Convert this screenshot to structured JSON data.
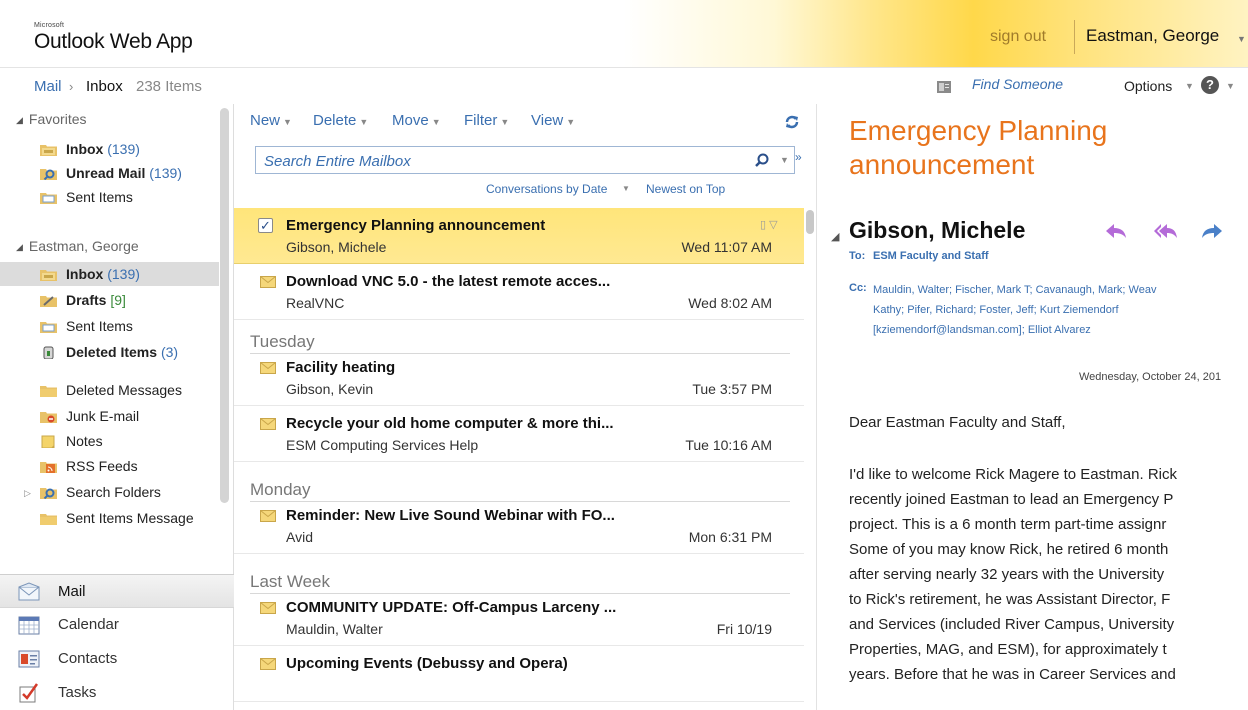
{
  "header": {
    "brand_small": "Microsoft",
    "app_title": "Outlook Web App",
    "sign_out": "sign out",
    "user_name": "Eastman, George"
  },
  "breadcrumb": {
    "mail": "Mail",
    "inbox": "Inbox",
    "count": "238 Items",
    "find_someone": "Find Someone",
    "options": "Options",
    "help": "?"
  },
  "nav": {
    "favorites_header": "Favorites",
    "favorites": [
      {
        "label": "Inbox",
        "count": "(139)",
        "icon": "inbox-folder-icon"
      },
      {
        "label": "Unread Mail",
        "count": "(139)",
        "icon": "search-folder-icon"
      },
      {
        "label": "Sent Items",
        "count": "",
        "icon": "sent-folder-icon"
      }
    ],
    "mailbox_header": "Eastman, George",
    "folders": [
      {
        "label": "Inbox",
        "count": "(139)"
      },
      {
        "label": "Drafts",
        "count": "[9]"
      },
      {
        "label": "Sent Items",
        "count": ""
      },
      {
        "label": "Deleted Items",
        "count": "(3)"
      },
      {
        "label": "Deleted Messages",
        "count": ""
      },
      {
        "label": "Junk E-mail",
        "count": ""
      },
      {
        "label": "Notes",
        "count": ""
      },
      {
        "label": "RSS Feeds",
        "count": ""
      },
      {
        "label": "Search Folders",
        "count": ""
      },
      {
        "label": "Sent Items Message",
        "count": ""
      }
    ],
    "modules": [
      "Mail",
      "Calendar",
      "Contacts",
      "Tasks"
    ]
  },
  "toolbar": {
    "new": "New",
    "delete": "Delete",
    "move": "Move",
    "filter": "Filter",
    "view": "View"
  },
  "search": {
    "placeholder": "Search Entire Mailbox"
  },
  "sort": {
    "by": "Conversations by Date",
    "order": "Newest on Top"
  },
  "groups": {
    "tuesday": "Tuesday",
    "monday": "Monday",
    "last_week": "Last Week"
  },
  "messages": [
    {
      "subject": "Emergency Planning announcement",
      "sender": "Gibson, Michele",
      "time": "Wed 11:07 AM"
    },
    {
      "subject": "Download VNC 5.0 - the latest remote acces...",
      "sender": "RealVNC",
      "time": "Wed 8:02 AM"
    },
    {
      "subject": "Facility heating",
      "sender": "Gibson, Kevin",
      "time": "Tue 3:57 PM"
    },
    {
      "subject": "Recycle your old home computer & more thi...",
      "sender": "ESM Computing Services Help",
      "time": "Tue 10:16 AM"
    },
    {
      "subject": "Reminder: New Live Sound Webinar with FO...",
      "sender": "Avid",
      "time": "Mon 6:31 PM"
    },
    {
      "subject": "COMMUNITY UPDATE: Off-Campus Larceny ...",
      "sender": "Mauldin, Walter",
      "time": "Fri 10/19"
    },
    {
      "subject": "Upcoming Events (Debussy and Opera)",
      "sender": "",
      "time": ""
    }
  ],
  "reading": {
    "subject": "Emergency Planning announcement",
    "from": "Gibson, Michele",
    "to_label": "To:",
    "to": "ESM Faculty and Staff",
    "cc_label": "Cc:",
    "cc_lines": [
      "Mauldin, Walter; Fischer, Mark T; Cavanaugh, Mark; Weav",
      "Kathy; Pifer, Richard; Foster, Jeff; Kurt Ziemendorf",
      "[kziemendorf@landsman.com]; Elliot Alvarez"
    ],
    "date": "Wednesday, October 24, 201",
    "greeting": "Dear Eastman Faculty and Staff,",
    "body_lines": [
      "I'd like to welcome Rick Magere to Eastman. Rick",
      "recently joined Eastman to lead an Emergency P",
      "project. This is a 6 month term part-time assignr",
      "Some of you may know Rick, he retired 6 month",
      "after serving nearly 32 years with the University",
      "to Rick's retirement, he was Assistant Director, F",
      "and Services (included River Campus, University",
      "Properties, MAG, and ESM), for approximately t",
      "years. Before that he was in Career Services and"
    ]
  }
}
